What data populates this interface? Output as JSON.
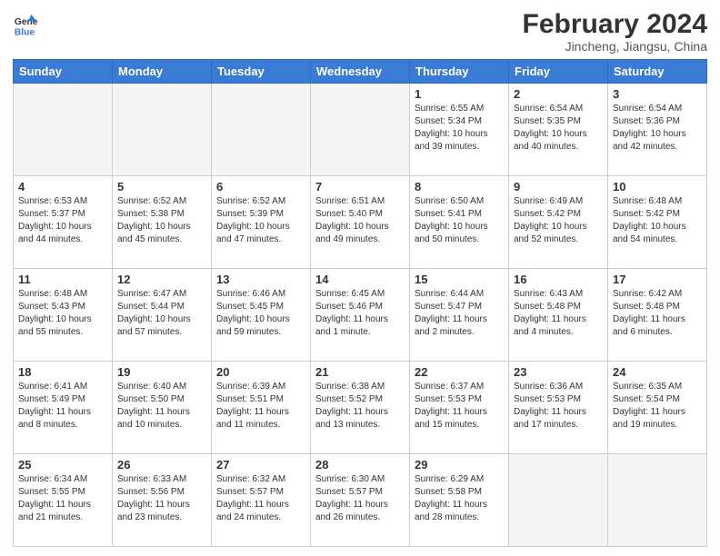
{
  "header": {
    "logo_line1": "General",
    "logo_line2": "Blue",
    "month_title": "February 2024",
    "subtitle": "Jincheng, Jiangsu, China"
  },
  "days_of_week": [
    "Sunday",
    "Monday",
    "Tuesday",
    "Wednesday",
    "Thursday",
    "Friday",
    "Saturday"
  ],
  "weeks": [
    [
      {
        "day": "",
        "info": ""
      },
      {
        "day": "",
        "info": ""
      },
      {
        "day": "",
        "info": ""
      },
      {
        "day": "",
        "info": ""
      },
      {
        "day": "1",
        "info": "Sunrise: 6:55 AM\nSunset: 5:34 PM\nDaylight: 10 hours\nand 39 minutes."
      },
      {
        "day": "2",
        "info": "Sunrise: 6:54 AM\nSunset: 5:35 PM\nDaylight: 10 hours\nand 40 minutes."
      },
      {
        "day": "3",
        "info": "Sunrise: 6:54 AM\nSunset: 5:36 PM\nDaylight: 10 hours\nand 42 minutes."
      }
    ],
    [
      {
        "day": "4",
        "info": "Sunrise: 6:53 AM\nSunset: 5:37 PM\nDaylight: 10 hours\nand 44 minutes."
      },
      {
        "day": "5",
        "info": "Sunrise: 6:52 AM\nSunset: 5:38 PM\nDaylight: 10 hours\nand 45 minutes."
      },
      {
        "day": "6",
        "info": "Sunrise: 6:52 AM\nSunset: 5:39 PM\nDaylight: 10 hours\nand 47 minutes."
      },
      {
        "day": "7",
        "info": "Sunrise: 6:51 AM\nSunset: 5:40 PM\nDaylight: 10 hours\nand 49 minutes."
      },
      {
        "day": "8",
        "info": "Sunrise: 6:50 AM\nSunset: 5:41 PM\nDaylight: 10 hours\nand 50 minutes."
      },
      {
        "day": "9",
        "info": "Sunrise: 6:49 AM\nSunset: 5:42 PM\nDaylight: 10 hours\nand 52 minutes."
      },
      {
        "day": "10",
        "info": "Sunrise: 6:48 AM\nSunset: 5:42 PM\nDaylight: 10 hours\nand 54 minutes."
      }
    ],
    [
      {
        "day": "11",
        "info": "Sunrise: 6:48 AM\nSunset: 5:43 PM\nDaylight: 10 hours\nand 55 minutes."
      },
      {
        "day": "12",
        "info": "Sunrise: 6:47 AM\nSunset: 5:44 PM\nDaylight: 10 hours\nand 57 minutes."
      },
      {
        "day": "13",
        "info": "Sunrise: 6:46 AM\nSunset: 5:45 PM\nDaylight: 10 hours\nand 59 minutes."
      },
      {
        "day": "14",
        "info": "Sunrise: 6:45 AM\nSunset: 5:46 PM\nDaylight: 11 hours\nand 1 minute."
      },
      {
        "day": "15",
        "info": "Sunrise: 6:44 AM\nSunset: 5:47 PM\nDaylight: 11 hours\nand 2 minutes."
      },
      {
        "day": "16",
        "info": "Sunrise: 6:43 AM\nSunset: 5:48 PM\nDaylight: 11 hours\nand 4 minutes."
      },
      {
        "day": "17",
        "info": "Sunrise: 6:42 AM\nSunset: 5:48 PM\nDaylight: 11 hours\nand 6 minutes."
      }
    ],
    [
      {
        "day": "18",
        "info": "Sunrise: 6:41 AM\nSunset: 5:49 PM\nDaylight: 11 hours\nand 8 minutes."
      },
      {
        "day": "19",
        "info": "Sunrise: 6:40 AM\nSunset: 5:50 PM\nDaylight: 11 hours\nand 10 minutes."
      },
      {
        "day": "20",
        "info": "Sunrise: 6:39 AM\nSunset: 5:51 PM\nDaylight: 11 hours\nand 11 minutes."
      },
      {
        "day": "21",
        "info": "Sunrise: 6:38 AM\nSunset: 5:52 PM\nDaylight: 11 hours\nand 13 minutes."
      },
      {
        "day": "22",
        "info": "Sunrise: 6:37 AM\nSunset: 5:53 PM\nDaylight: 11 hours\nand 15 minutes."
      },
      {
        "day": "23",
        "info": "Sunrise: 6:36 AM\nSunset: 5:53 PM\nDaylight: 11 hours\nand 17 minutes."
      },
      {
        "day": "24",
        "info": "Sunrise: 6:35 AM\nSunset: 5:54 PM\nDaylight: 11 hours\nand 19 minutes."
      }
    ],
    [
      {
        "day": "25",
        "info": "Sunrise: 6:34 AM\nSunset: 5:55 PM\nDaylight: 11 hours\nand 21 minutes."
      },
      {
        "day": "26",
        "info": "Sunrise: 6:33 AM\nSunset: 5:56 PM\nDaylight: 11 hours\nand 23 minutes."
      },
      {
        "day": "27",
        "info": "Sunrise: 6:32 AM\nSunset: 5:57 PM\nDaylight: 11 hours\nand 24 minutes."
      },
      {
        "day": "28",
        "info": "Sunrise: 6:30 AM\nSunset: 5:57 PM\nDaylight: 11 hours\nand 26 minutes."
      },
      {
        "day": "29",
        "info": "Sunrise: 6:29 AM\nSunset: 5:58 PM\nDaylight: 11 hours\nand 28 minutes."
      },
      {
        "day": "",
        "info": ""
      },
      {
        "day": "",
        "info": ""
      }
    ]
  ]
}
